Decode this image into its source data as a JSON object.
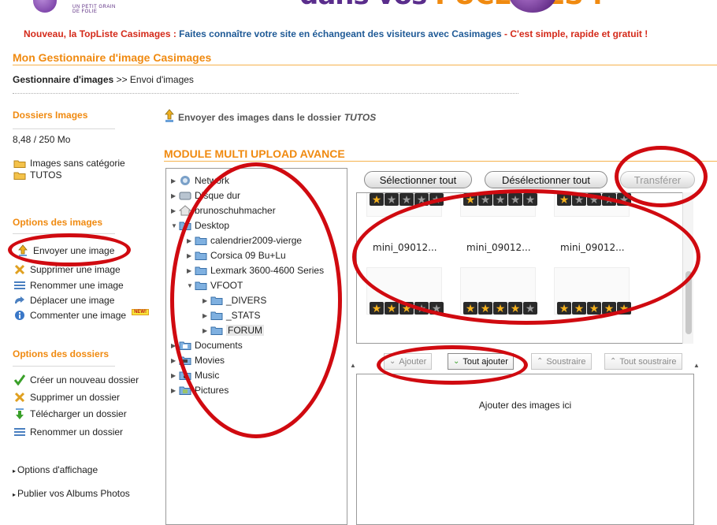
{
  "banner": {
    "left_tagline": "UN PETIT GRAIN DE FOLIE",
    "mid_text_a": "dans vos ",
    "mid_text_b": "PUCETTES !"
  },
  "promo": {
    "lead": "Nouveau, la TopListe Casimages :",
    "middle": " Faites connaître votre site en échangeant des visiteurs avec Casimages ",
    "tail": "- C'est simple, rapide et gratuit !"
  },
  "page_title": "Mon Gestionnaire d'image Casimages",
  "breadcrumb": {
    "root": "Gestionnaire d'images",
    "sep": " >> ",
    "current": "Envoi d'images"
  },
  "sidebar": {
    "folders_heading": "Dossiers Images",
    "quota": "8,48 / 250 Mo",
    "folders": [
      {
        "label": "Images sans catégorie"
      },
      {
        "label": "TUTOS"
      }
    ],
    "image_options_heading": "Options des images",
    "image_options": [
      {
        "label": "Envoyer une image",
        "icon": "upload-icon"
      },
      {
        "label": "Supprimer une image",
        "icon": "delete-x-icon"
      },
      {
        "label": "Renommer une image",
        "icon": "list-icon"
      },
      {
        "label": "Déplacer une image",
        "icon": "move-arrow-icon"
      },
      {
        "label": "Commenter une image",
        "icon": "info-icon",
        "badge": "NEW!"
      }
    ],
    "folder_options_heading": "Options des dossiers",
    "folder_options": [
      {
        "label": "Créer un nouveau dossier",
        "icon": "check-icon"
      },
      {
        "label": "Supprimer un dossier",
        "icon": "delete-x-icon"
      },
      {
        "label": "Télécharger un dossier",
        "icon": "download-icon"
      },
      {
        "label": "Renommer un dossier",
        "icon": "list-icon"
      }
    ],
    "display_options": "Options d'affichage",
    "publish_albums": "Publier vos Albums Photos"
  },
  "main": {
    "upload_caption": "Envoyer des images dans le dossier",
    "upload_folder": "TUTOS",
    "module_title": "MODULE MULTI UPLOAD AVANCE",
    "tree": [
      {
        "label": "Network",
        "level": 0,
        "expanded": false,
        "icon": "network-icon"
      },
      {
        "label": "Disque dur",
        "level": 0,
        "expanded": false,
        "icon": "drive-icon"
      },
      {
        "label": "brunoschuhmacher",
        "level": 0,
        "expanded": false,
        "icon": "home-icon"
      },
      {
        "label": "Desktop",
        "level": 0,
        "expanded": true,
        "icon": "desktop-icon"
      },
      {
        "label": "calendrier2009-vierge",
        "level": 1,
        "expanded": false,
        "icon": "folder-icon"
      },
      {
        "label": "Corsica 09 Bu+Lu",
        "level": 1,
        "expanded": false,
        "icon": "folder-icon"
      },
      {
        "label": "Lexmark 3600-4600 Series",
        "level": 1,
        "expanded": false,
        "icon": "folder-icon"
      },
      {
        "label": "VFOOT",
        "level": 1,
        "expanded": true,
        "icon": "folder-icon"
      },
      {
        "label": "_DIVERS",
        "level": 2,
        "expanded": false,
        "icon": "folder-icon"
      },
      {
        "label": "_STATS",
        "level": 2,
        "expanded": false,
        "icon": "folder-icon"
      },
      {
        "label": "FORUM",
        "level": 2,
        "expanded": false,
        "icon": "folder-icon",
        "selected": true
      },
      {
        "label": "Documents",
        "level": 0,
        "expanded": false,
        "icon": "documents-icon"
      },
      {
        "label": "Movies",
        "level": 0,
        "expanded": false,
        "icon": "movies-icon"
      },
      {
        "label": "Music",
        "level": 0,
        "expanded": false,
        "icon": "music-icon"
      },
      {
        "label": "Pictures",
        "level": 0,
        "expanded": false,
        "icon": "pictures-icon"
      }
    ],
    "select_all": "Sélectionner tout",
    "deselect_all": "Désélectionner tout",
    "transfer": "Transférer",
    "thumbnails": [
      {
        "name": "mini_09012...",
        "gold_stars": 1
      },
      {
        "name": "mini_09012...",
        "gold_stars": 1
      },
      {
        "name": "mini_09012...",
        "gold_stars": 1
      },
      {
        "name": "",
        "gold_stars": 3
      },
      {
        "name": "",
        "gold_stars": 5
      },
      {
        "name": "",
        "gold_stars": 5
      }
    ],
    "add": "Ajouter",
    "add_all": "Tout ajouter",
    "subtract": "Soustraire",
    "subtract_all": "Tout soustraire",
    "dropzone_text": "Ajouter des images ici"
  },
  "colors": {
    "accent_orange": "#f08a10",
    "promo_red": "#d42a1a",
    "promo_blue": "#1f5a96",
    "annotation_red": "#d00a10"
  }
}
